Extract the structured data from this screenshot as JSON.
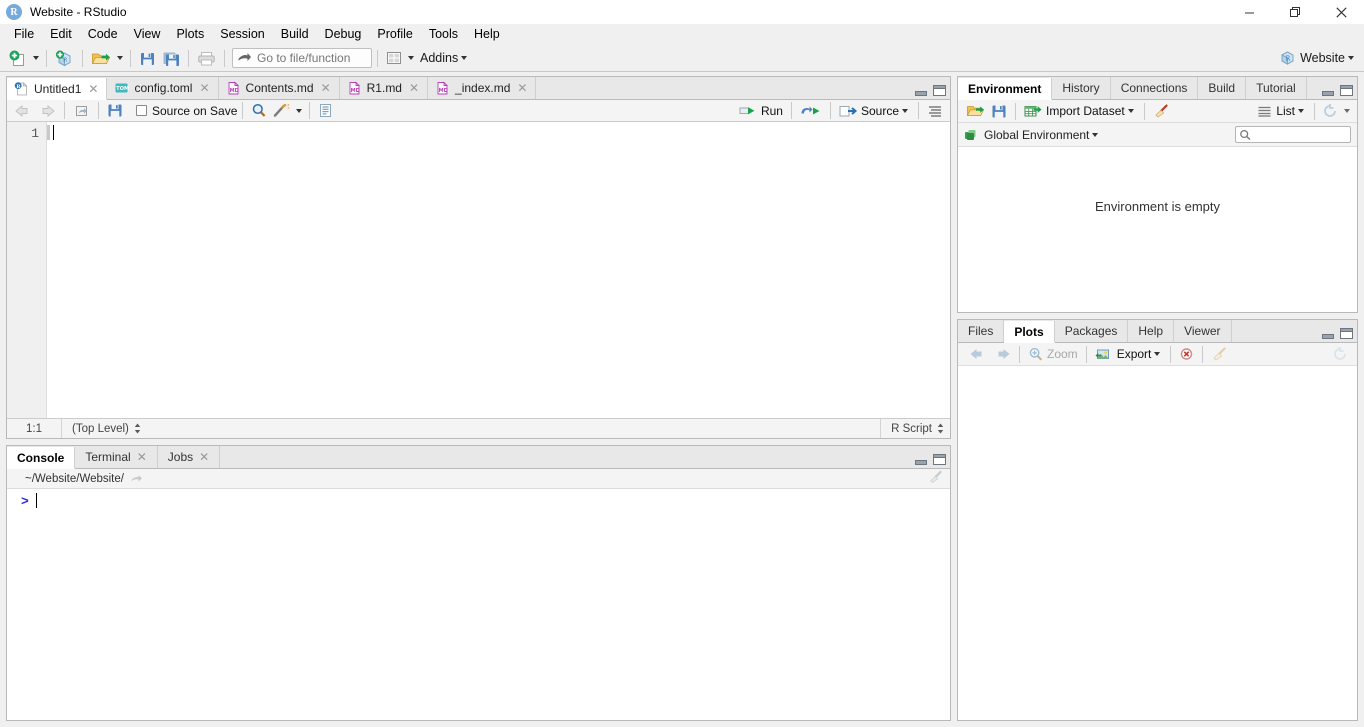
{
  "window": {
    "title": "Website - RStudio",
    "app_icon": "rstudio-icon",
    "controls": [
      {
        "name": "minimize",
        "glyph": "minimize-icon"
      },
      {
        "name": "restore",
        "glyph": "restore-icon"
      },
      {
        "name": "close",
        "glyph": "close-icon"
      }
    ]
  },
  "menubar": {
    "items": [
      "File",
      "Edit",
      "Code",
      "View",
      "Plots",
      "Session",
      "Build",
      "Debug",
      "Profile",
      "Tools",
      "Help"
    ]
  },
  "toolbar": {
    "new_file_icon": "new-file-icon",
    "new_project_icon": "new-project-icon",
    "open_file_icon": "open-folder-icon",
    "save_icon": "save-icon",
    "save_all_icon": "save-all-icon",
    "print_icon": "print-icon",
    "goto_placeholder": "Go to file/function",
    "panes_icon": "workspace-panes-icon",
    "addins_label": "Addins",
    "project_label": "Website",
    "project_icon": "rstudio-project-icon"
  },
  "source": {
    "tabs": [
      {
        "label": "Untitled1",
        "icon": "r-script-icon",
        "icon_text": "R",
        "icon_color": "#2c72b8",
        "active": true,
        "closable": true
      },
      {
        "label": "config.toml",
        "icon": "toml-file-icon",
        "icon_text": "TOML",
        "icon_color": "#3fb9bd",
        "active": false,
        "closable": true
      },
      {
        "label": "Contents.md",
        "icon": "markdown-file-icon",
        "icon_text": "MD",
        "icon_color": "#b93fb9",
        "active": false,
        "closable": true
      },
      {
        "label": "R1.md",
        "icon": "markdown-file-icon",
        "icon_text": "MD",
        "icon_color": "#b93fb9",
        "active": false,
        "closable": true
      },
      {
        "label": "_index.md",
        "icon": "markdown-file-icon",
        "icon_text": "MD",
        "icon_color": "#b93fb9",
        "active": false,
        "closable": true
      }
    ],
    "toolbar": {
      "back_icon": "arrow-back-icon",
      "forward_icon": "arrow-forward-icon",
      "popout_icon": "show-in-new-window-icon",
      "save_icon": "save-icon",
      "source_on_save_label": "Source on Save",
      "source_on_save_checked": false,
      "find_icon": "magnifier-icon",
      "magic_icon": "code-tools-icon",
      "compile_report_icon": "compile-report-icon",
      "run_label": "Run",
      "rerun_icon": "re-run-icon",
      "source_label": "Source",
      "outline_icon": "document-outline-icon"
    },
    "editor": {
      "line_numbers": [
        "1"
      ],
      "content": [
        ""
      ]
    },
    "status": {
      "cursor_position": "1:1",
      "scope": "(Top Level)",
      "file_type": "R Script"
    }
  },
  "console_pane": {
    "tabs": [
      {
        "label": "Console",
        "active": true,
        "closable": false
      },
      {
        "label": "Terminal",
        "active": false,
        "closable": true
      },
      {
        "label": "Jobs",
        "active": false,
        "closable": true
      }
    ],
    "working_directory": "~/Website/Website/",
    "directory_open_icon": "open-directory-icon",
    "clear_console_icon": "broom-icon",
    "prompt": ">",
    "input_value": ""
  },
  "environment_pane": {
    "tabs": [
      {
        "label": "Environment",
        "active": true
      },
      {
        "label": "History",
        "active": false
      },
      {
        "label": "Connections",
        "active": false
      },
      {
        "label": "Build",
        "active": false
      },
      {
        "label": "Tutorial",
        "active": false
      }
    ],
    "toolbar": {
      "load_icon": "open-folder-icon",
      "save_icon": "save-icon",
      "import_dataset_label": "Import Dataset",
      "import_dataset_icon": "import-dataset-icon",
      "clear_icon": "broom-icon",
      "view_mode_label": "List",
      "view_mode_icon": "list-icon",
      "refresh_icon": "refresh-icon"
    },
    "scope_selector": {
      "label": "Global Environment",
      "icon": "environment-cube-icon"
    },
    "search_placeholder": "",
    "search_icon": "magnifier-icon",
    "empty_message": "Environment is empty"
  },
  "files_pane": {
    "tabs": [
      {
        "label": "Files",
        "active": false
      },
      {
        "label": "Plots",
        "active": true
      },
      {
        "label": "Packages",
        "active": false
      },
      {
        "label": "Help",
        "active": false
      },
      {
        "label": "Viewer",
        "active": false
      }
    ],
    "toolbar": {
      "back_icon": "arrow-back-icon",
      "forward_icon": "arrow-forward-icon",
      "zoom_label": "Zoom",
      "zoom_icon": "magnifier-plus-icon",
      "export_label": "Export",
      "export_icon": "export-image-icon",
      "remove_plot_icon": "remove-plot-icon",
      "clear_plots_icon": "broom-icon",
      "refresh_icon": "refresh-icon"
    }
  },
  "colors": {
    "accent_blue": "#75aadb",
    "prompt_blue": "#2b2bd6",
    "panel_bg": "#f0f0f0",
    "border": "#b9b9b9",
    "tab_inactive": "#e8e8e8",
    "markdown_icon": "#b93fb9",
    "toml_icon": "#3fb9bd"
  }
}
